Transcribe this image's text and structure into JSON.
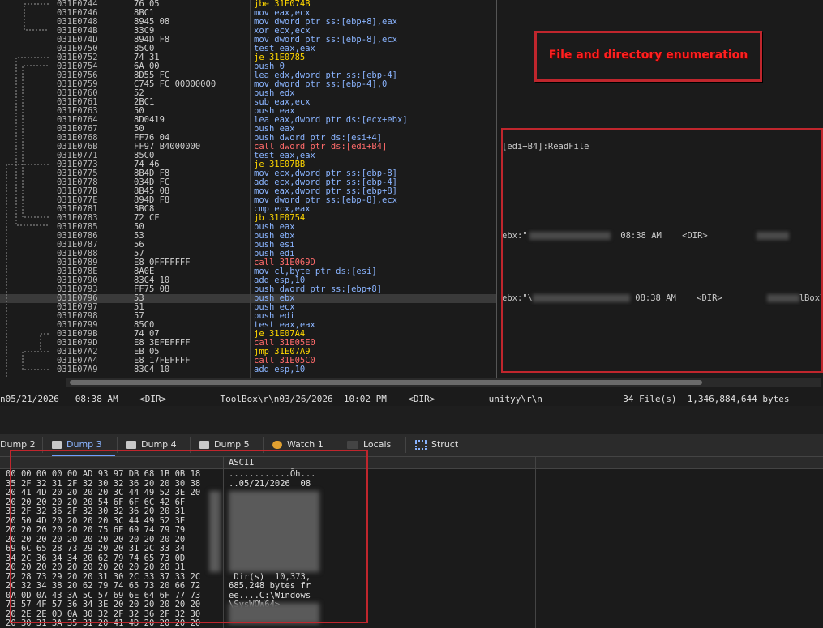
{
  "disasm_rows": [
    {
      "addr": "031E0744",
      "bytes": "76 05",
      "instr": "jbe 31E074B",
      "kind": "jmp"
    },
    {
      "addr": "031E0746",
      "bytes": "8BC1",
      "instr": "mov eax,ecx",
      "kind": "normal"
    },
    {
      "addr": "031E0748",
      "bytes": "8945 08",
      "instr": "mov dword ptr ss:[ebp+8],eax",
      "kind": "normal"
    },
    {
      "addr": "031E074B",
      "bytes": "33C9",
      "instr": "xor ecx,ecx",
      "kind": "normal"
    },
    {
      "addr": "031E074D",
      "bytes": "894D F8",
      "instr": "mov dword ptr ss:[ebp-8],ecx",
      "kind": "normal"
    },
    {
      "addr": "031E0750",
      "bytes": "85C0",
      "instr": "test eax,eax",
      "kind": "normal"
    },
    {
      "addr": "031E0752",
      "bytes": "74 31",
      "instr": "je 31E0785",
      "kind": "jmp"
    },
    {
      "addr": "031E0754",
      "bytes": "6A 00",
      "instr": "push 0",
      "kind": "normal"
    },
    {
      "addr": "031E0756",
      "bytes": "8D55 FC",
      "instr": "lea edx,dword ptr ss:[ebp-4]",
      "kind": "normal"
    },
    {
      "addr": "031E0759",
      "bytes": "C745 FC 00000000",
      "instr": "mov dword ptr ss:[ebp-4],0",
      "kind": "normal"
    },
    {
      "addr": "031E0760",
      "bytes": "52",
      "instr": "push edx",
      "kind": "normal"
    },
    {
      "addr": "031E0761",
      "bytes": "2BC1",
      "instr": "sub eax,ecx",
      "kind": "normal"
    },
    {
      "addr": "031E0763",
      "bytes": "50",
      "instr": "push eax",
      "kind": "normal"
    },
    {
      "addr": "031E0764",
      "bytes": "8D0419",
      "instr": "lea eax,dword ptr ds:[ecx+ebx]",
      "kind": "normal"
    },
    {
      "addr": "031E0767",
      "bytes": "50",
      "instr": "push eax",
      "kind": "normal"
    },
    {
      "addr": "031E0768",
      "bytes": "FF76 04",
      "instr": "push dword ptr ds:[esi+4]",
      "kind": "normal"
    },
    {
      "addr": "031E076B",
      "bytes": "FF97 B4000000",
      "instr": "call dword ptr ds:[edi+B4]",
      "kind": "call"
    },
    {
      "addr": "031E0771",
      "bytes": "85C0",
      "instr": "test eax,eax",
      "kind": "normal"
    },
    {
      "addr": "031E0773",
      "bytes": "74 46",
      "instr": "je 31E07BB",
      "kind": "jmp"
    },
    {
      "addr": "031E0775",
      "bytes": "8B4D F8",
      "instr": "mov ecx,dword ptr ss:[ebp-8]",
      "kind": "normal"
    },
    {
      "addr": "031E0778",
      "bytes": "034D FC",
      "instr": "add ecx,dword ptr ss:[ebp-4]",
      "kind": "normal"
    },
    {
      "addr": "031E077B",
      "bytes": "8B45 08",
      "instr": "mov eax,dword ptr ss:[ebp+8]",
      "kind": "normal"
    },
    {
      "addr": "031E077E",
      "bytes": "894D F8",
      "instr": "mov dword ptr ss:[ebp-8],ecx",
      "kind": "normal"
    },
    {
      "addr": "031E0781",
      "bytes": "3BC8",
      "instr": "cmp ecx,eax",
      "kind": "normal"
    },
    {
      "addr": "031E0783",
      "bytes": "72 CF",
      "instr": "jb 31E0754",
      "kind": "jmp"
    },
    {
      "addr": "031E0785",
      "bytes": "50",
      "instr": "push eax",
      "kind": "normal"
    },
    {
      "addr": "031E0786",
      "bytes": "53",
      "instr": "push ebx",
      "kind": "normal"
    },
    {
      "addr": "031E0787",
      "bytes": "56",
      "instr": "push esi",
      "kind": "normal"
    },
    {
      "addr": "031E0788",
      "bytes": "57",
      "instr": "push edi",
      "kind": "normal"
    },
    {
      "addr": "031E0789",
      "bytes": "E8 0FFFFFFF",
      "instr": "call 31E069D",
      "kind": "call"
    },
    {
      "addr": "031E078E",
      "bytes": "8A0E",
      "instr": "mov cl,byte ptr ds:[esi]",
      "kind": "normal"
    },
    {
      "addr": "031E0790",
      "bytes": "83C4 10",
      "instr": "add esp,10",
      "kind": "normal"
    },
    {
      "addr": "031E0793",
      "bytes": "FF75 08",
      "instr": "push dword ptr ss:[ebp+8]",
      "kind": "normal"
    },
    {
      "addr": "031E0796",
      "bytes": "53",
      "instr": "push ebx",
      "kind": "normal",
      "selected": true
    },
    {
      "addr": "031E0797",
      "bytes": "51",
      "instr": "push ecx",
      "kind": "normal"
    },
    {
      "addr": "031E0798",
      "bytes": "57",
      "instr": "push edi",
      "kind": "normal"
    },
    {
      "addr": "031E0799",
      "bytes": "85C0",
      "instr": "test eax,eax",
      "kind": "normal"
    },
    {
      "addr": "031E079B",
      "bytes": "74 07",
      "instr": "je 31E07A4",
      "kind": "jmp"
    },
    {
      "addr": "031E079D",
      "bytes": "E8 3EFEFFFF",
      "instr": "call 31E05E0",
      "kind": "call"
    },
    {
      "addr": "031E07A2",
      "bytes": "EB 05",
      "instr": "jmp 31E07A9",
      "kind": "jmp"
    },
    {
      "addr": "031E07A4",
      "bytes": "E8 17FEFFFF",
      "instr": "call 31E05C0",
      "kind": "call"
    },
    {
      "addr": "031E07A9",
      "bytes": "83C4 10",
      "instr": "add esp,10",
      "kind": "normal"
    }
  ],
  "comments": {
    "readfile": "[edi+B4]:ReadFile",
    "ebx1_prefix": "ebx:\"",
    "ebx1_mid": "08:38 AM    <DIR>",
    "ebx2_prefix": "ebx:\"\\",
    "ebx2_mid": "08:38 AM    <DIR>",
    "ebx2_suffix": "lBox\\r"
  },
  "info_line": "n05/21/2026   08:38 AM    <DIR>          ToolBox\\r\\n03/26/2026  10:02 PM    <DIR>          unityy\\r\\n               34 File(s)  1,346,884,644 bytes",
  "annotation": "File and directory enumeration",
  "tabs": [
    {
      "label": "Dump 2",
      "active": false
    },
    {
      "label": "Dump 3",
      "active": true
    },
    {
      "label": "Dump 4",
      "active": false
    },
    {
      "label": "Dump 5",
      "active": false
    },
    {
      "label": "Watch 1",
      "active": false
    },
    {
      "label": "Locals",
      "active": false
    },
    {
      "label": "Struct",
      "active": false
    }
  ],
  "dump": {
    "ascii_header": "ASCII",
    "hex_rows": [
      "00 00 00 00 00 AD 93 97 DB 68 1B 0B 18",
      "35 2F 32 31 2F 32 30 32 36 20 20 30 38",
      "20 41 4D 20 20 20 20 3C 44 49 52 3E 20",
      "20 20 20 20 20 20 54 6F 6F 6C 42 6F",
      "33 2F 32 36 2F 32 30 32 36 20 20 31",
      "20 50 4D 20 20 20 20 3C 44 49 52 3E",
      "20 20 20 20 20 20 75 6E 69 74 79 79",
      "20 20 20 20 20 20 20 20 20 20 20 20",
      "69 6C 65 28 73 29 20 20 31 2C 33 34",
      "34 2C 36 34 34 20 62 79 74 65 73 0D",
      "20 20 20 20 20 20 20 20 20 20 20 31",
      "72 28 73 29 20 20 31 30 2C 33 37 33 2C",
      "2C 32 34 38 20 62 79 74 65 73 20 66 72",
      "0A 0D 0A 43 3A 5C 57 69 6E 64 6F 77 73",
      "73 57 4F 57 36 34 3E 20 20 20 20 20 20",
      "20 2E 2E 0D 0A 30 32 2F 32 36 2F 32 30",
      "20 30 31 3A 35 31 20 41 4D 20 20 20 20"
    ],
    "ascii_rows": [
      "............Öh...",
      "..05/21/2026  08",
      "",
      "",
      "",
      "",
      "",
      "",
      "",
      "",
      "",
      " Dir(s)  10,373,",
      "685,248 bytes fr",
      "ee....C:\\Windows",
      "\\SysWOW64>",
      "",
      ""
    ]
  }
}
